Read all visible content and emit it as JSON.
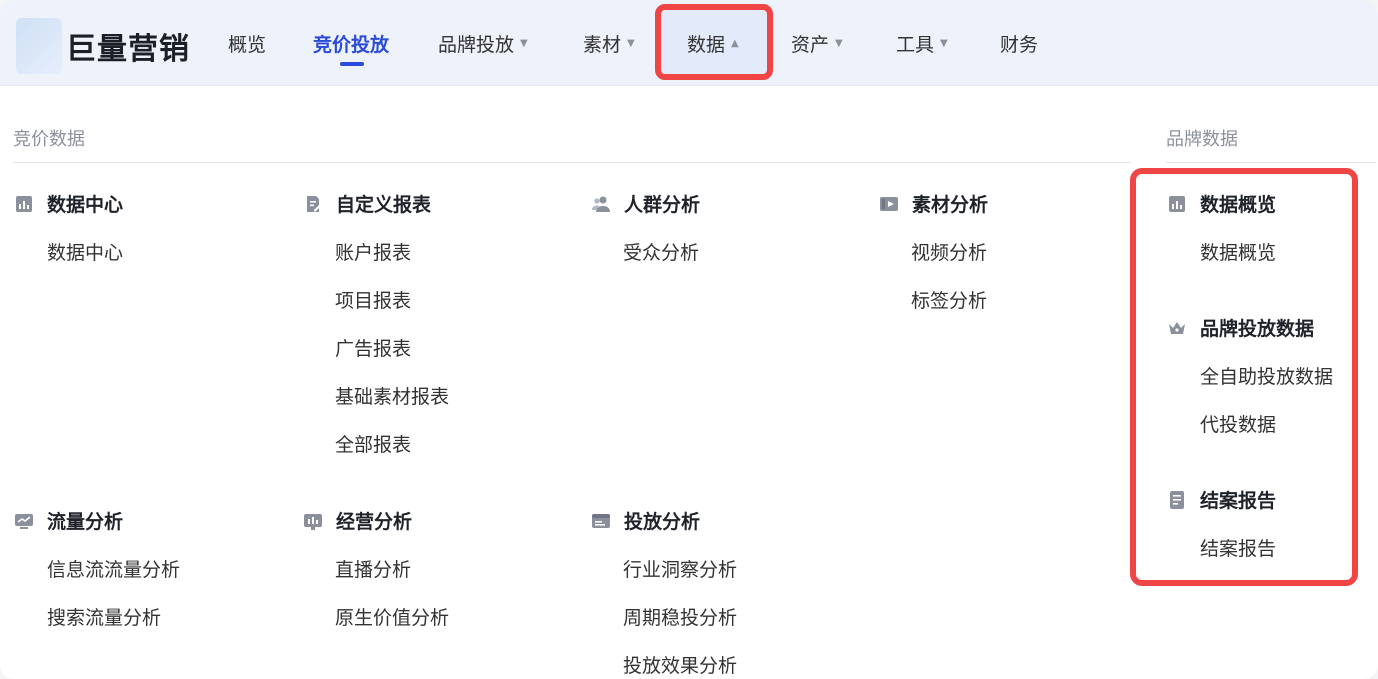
{
  "header": {
    "brand": "巨量营销",
    "nav": [
      {
        "label": "概览"
      },
      {
        "label": "竞价投放"
      },
      {
        "label": "品牌投放"
      },
      {
        "label": "素材"
      },
      {
        "label": "数据"
      },
      {
        "label": "资产"
      },
      {
        "label": "工具"
      },
      {
        "label": "财务"
      }
    ]
  },
  "menu": {
    "bidding_title": "竞价数据",
    "brand_title": "品牌数据",
    "groups": {
      "data_center": {
        "title": "数据中心",
        "items": [
          "数据中心"
        ]
      },
      "custom_report": {
        "title": "自定义报表",
        "items": [
          "账户报表",
          "项目报表",
          "广告报表",
          "基础素材报表",
          "全部报表"
        ]
      },
      "crowd": {
        "title": "人群分析",
        "items": [
          "受众分析"
        ]
      },
      "material": {
        "title": "素材分析",
        "items": [
          "视频分析",
          "标签分析"
        ]
      },
      "traffic": {
        "title": "流量分析",
        "items": [
          "信息流流量分析",
          "搜索流量分析"
        ]
      },
      "business": {
        "title": "经营分析",
        "items": [
          "直播分析",
          "原生价值分析"
        ]
      },
      "delivery": {
        "title": "投放分析",
        "items": [
          "行业洞察分析",
          "周期稳投分析",
          "投放效果分析"
        ]
      },
      "brand_overview": {
        "title": "数据概览",
        "items": [
          "数据概览"
        ]
      },
      "brand_delivery": {
        "title": "品牌投放数据",
        "items": [
          "全自助投放数据",
          "代投数据"
        ]
      },
      "closing": {
        "title": "结案报告",
        "items": [
          "结案报告"
        ]
      }
    }
  },
  "colors": {
    "accent": "#2a4bd8",
    "highlight": "#ef4545"
  }
}
